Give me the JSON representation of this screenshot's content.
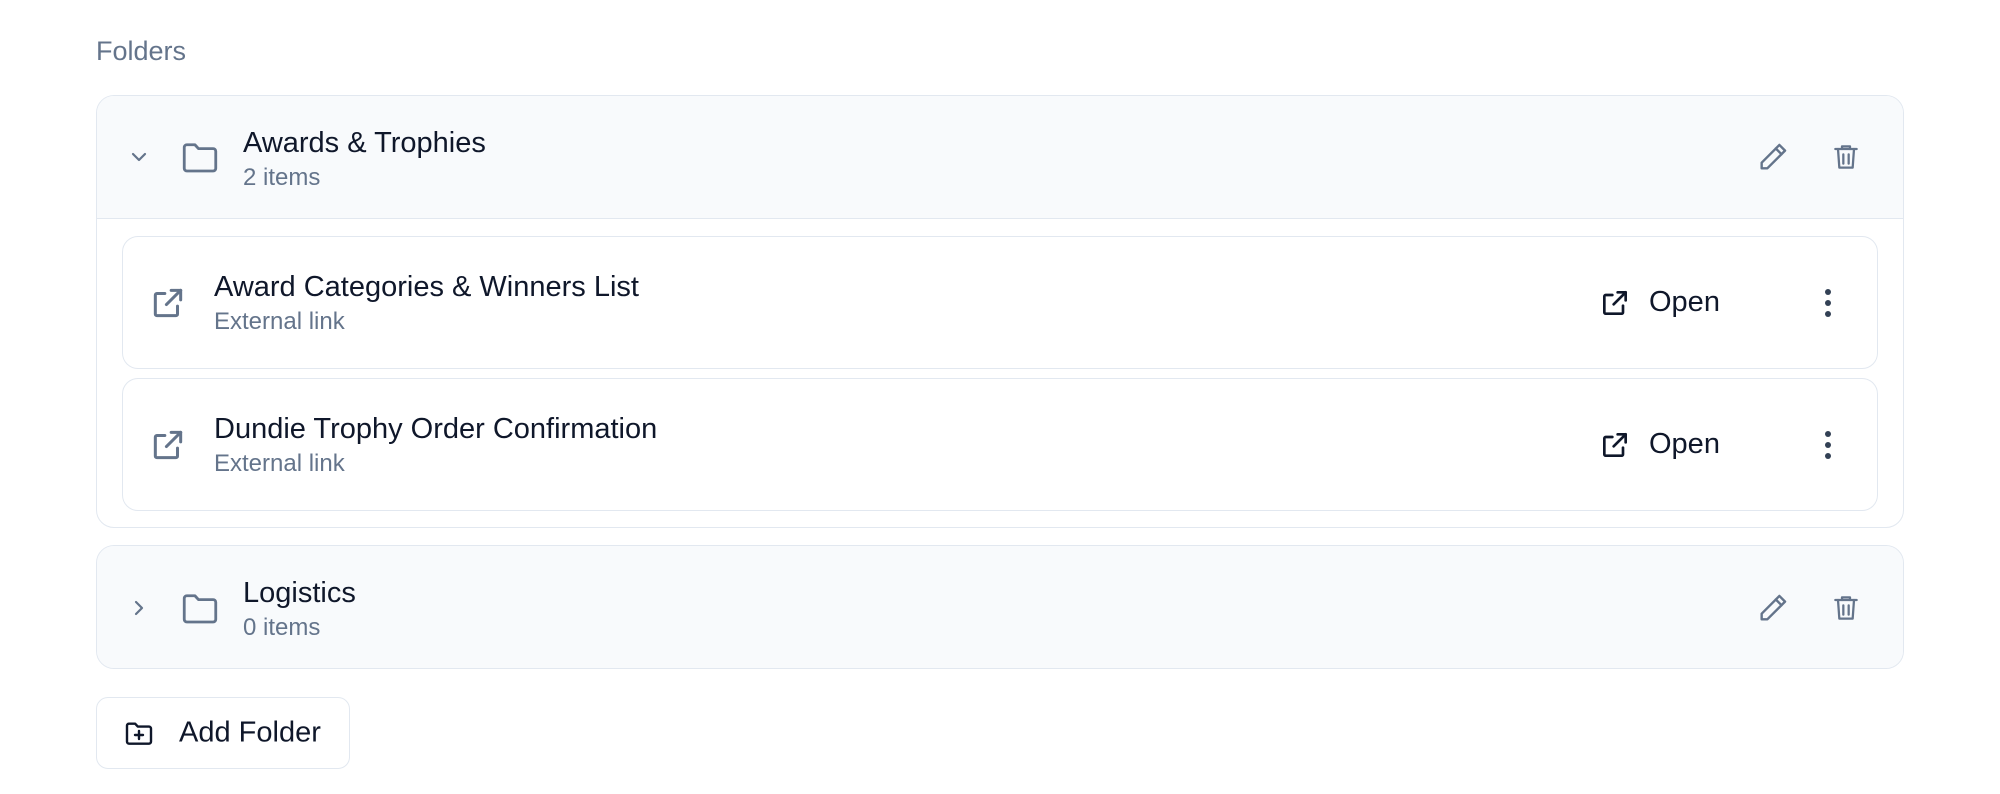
{
  "section": {
    "title": "Folders"
  },
  "folders": [
    {
      "name": "Awards & Trophies",
      "count": "2 items",
      "expanded": true,
      "items": [
        {
          "title": "Award Categories & Winners List",
          "subtitle": "External link",
          "open_label": "Open"
        },
        {
          "title": "Dundie Trophy Order Confirmation",
          "subtitle": "External link",
          "open_label": "Open"
        }
      ]
    },
    {
      "name": "Logistics",
      "count": "0 items",
      "expanded": false,
      "items": []
    }
  ],
  "actions": {
    "add_folder_label": "Add Folder"
  },
  "icons": {
    "chevron_expanded": "chevron-down-icon",
    "chevron_collapsed": "chevron-right-icon",
    "folder": "folder-icon",
    "edit": "pencil-icon",
    "delete": "trash-icon",
    "external_link": "external-link-icon",
    "more": "more-vertical-icon",
    "add_folder": "folder-plus-icon"
  },
  "colors": {
    "muted_text": "#64748b",
    "border": "#e2e8f0",
    "header_bg": "#f8fafc",
    "icon": "#64748b"
  }
}
